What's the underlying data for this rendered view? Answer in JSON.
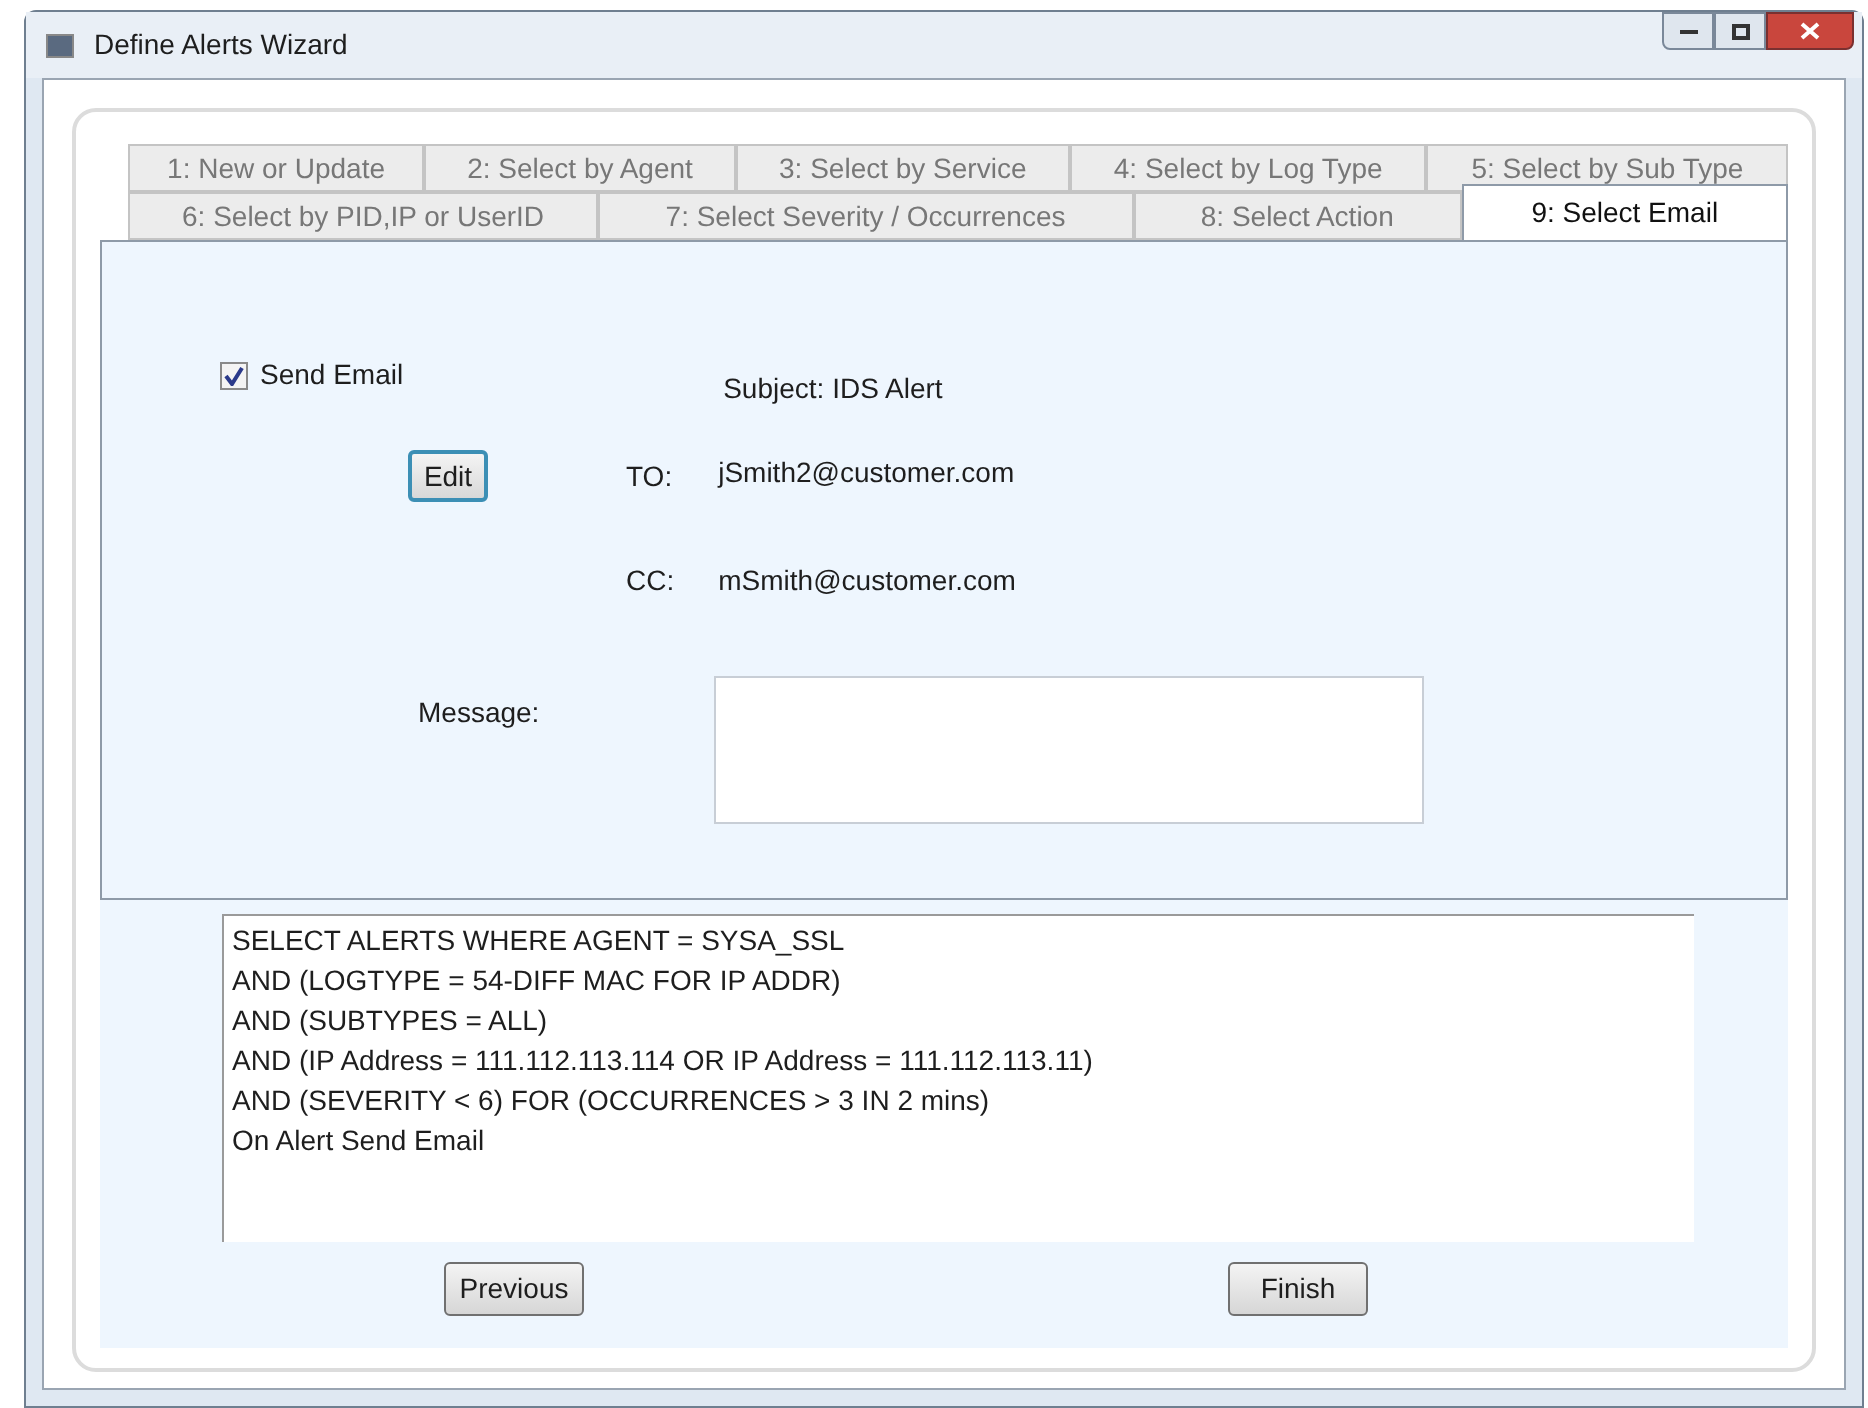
{
  "window": {
    "title": "Define Alerts Wizard"
  },
  "tab_rows": [
    [
      {
        "label": "1: New or Update",
        "selected": false
      },
      {
        "label": "2: Select by Agent",
        "selected": false
      },
      {
        "label": "3: Select by Service",
        "selected": false
      },
      {
        "label": "4: Select by Log Type",
        "selected": false
      },
      {
        "label": "5: Select by Sub Type",
        "selected": false
      }
    ],
    [
      {
        "label": "6: Select by PID,IP or UserID",
        "selected": false
      },
      {
        "label": "7: Select Severity / Occurrences",
        "selected": false
      },
      {
        "label": "8: Select Action",
        "selected": false
      },
      {
        "label": "9: Select Email",
        "selected": true
      }
    ]
  ],
  "send_email": {
    "label": "Send Email",
    "checked": true
  },
  "subject": "Subject: IDS Alert",
  "edit_button": "Edit",
  "to": {
    "label": "TO:",
    "value": "jSmith2@customer.com"
  },
  "cc": {
    "label": "CC:",
    "value": "mSmith@customer.com"
  },
  "message": {
    "label": "Message:"
  },
  "query_lines": [
    "SELECT ALERTS WHERE AGENT = SYSA_SSL",
    "AND (LOGTYPE = 54-DIFF MAC FOR IP ADDR)",
    "AND (SUBTYPES = ALL)",
    "AND (IP Address = 111.112.113.114 OR IP Address = 111.112.113.11)",
    "AND (SEVERITY < 6) FOR (OCCURRENCES > 3 IN 2 mins)",
    "On Alert Send Email"
  ],
  "buttons": [
    "Previous",
    "Finish"
  ]
}
